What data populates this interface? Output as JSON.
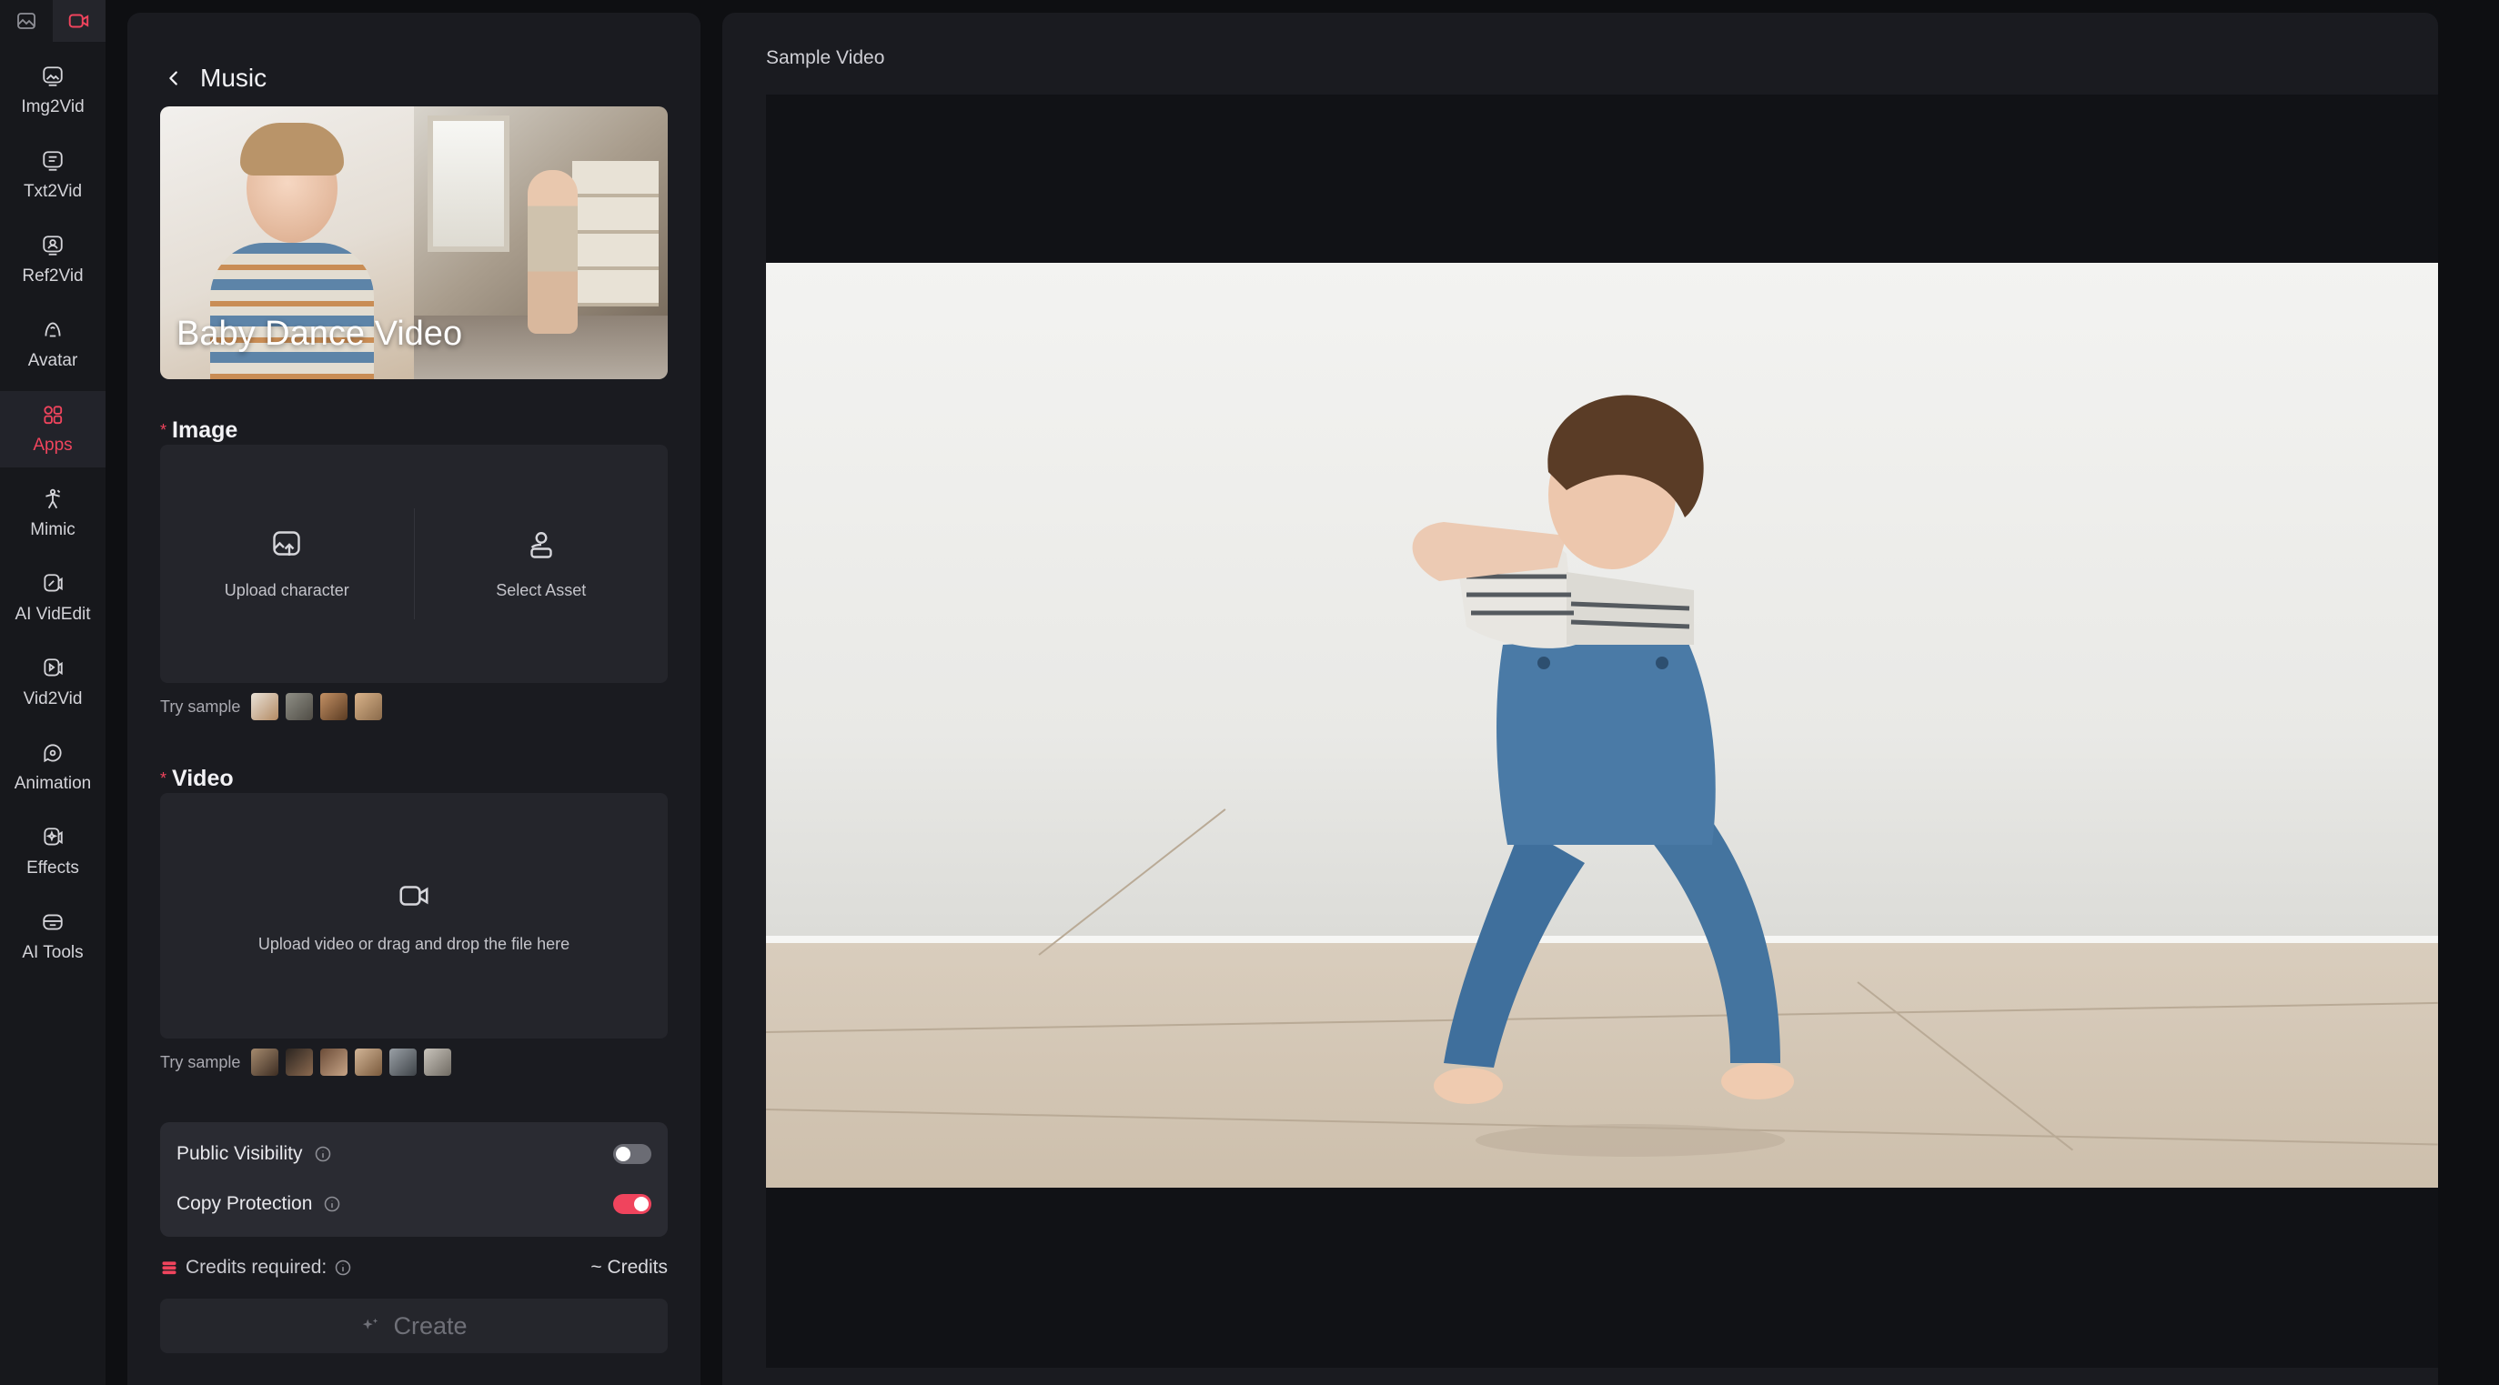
{
  "rail": {
    "top_tabs": [
      "image-tab",
      "video-tab"
    ],
    "items": [
      {
        "label": "Img2Vid",
        "icon": "image-video-icon"
      },
      {
        "label": "Txt2Vid",
        "icon": "text-video-icon"
      },
      {
        "label": "Ref2Vid",
        "icon": "reference-video-icon"
      },
      {
        "label": "Avatar",
        "icon": "avatar-icon"
      },
      {
        "label": "Apps",
        "icon": "apps-icon",
        "active": true
      },
      {
        "label": "Mimic",
        "icon": "mimic-icon"
      },
      {
        "label": "AI VidEdit",
        "icon": "video-edit-icon"
      },
      {
        "label": "Vid2Vid",
        "icon": "video-video-icon"
      },
      {
        "label": "Animation",
        "icon": "animation-icon"
      },
      {
        "label": "Effects",
        "icon": "effects-icon"
      },
      {
        "label": "AI Tools",
        "icon": "tools-icon"
      }
    ]
  },
  "panel": {
    "back_title": "Music",
    "banner_title": "Baby Dance Video",
    "image_section": {
      "label": "Image",
      "upload_label": "Upload character",
      "asset_label": "Select Asset"
    },
    "image_samples": {
      "label": "Try sample",
      "count": 4
    },
    "video_section": {
      "label": "Video",
      "upload_label": "Upload video or drag and drop the file here"
    },
    "video_samples": {
      "label": "Try sample",
      "count": 6
    },
    "settings": {
      "public_visibility": {
        "label": "Public Visibility",
        "enabled": false
      },
      "copy_protection": {
        "label": "Copy Protection",
        "enabled": true
      }
    },
    "credits": {
      "label": "Credits required:",
      "value": "~ Credits"
    },
    "create_label": "Create"
  },
  "preview": {
    "title": "Sample Video"
  },
  "colors": {
    "accent": "#f0445d",
    "background": "#0e0f12",
    "panel": "#1a1b20",
    "card": "#24252b"
  }
}
